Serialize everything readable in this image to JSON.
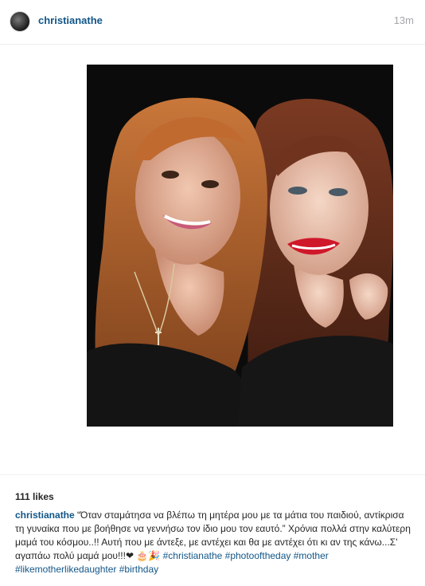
{
  "post": {
    "username": "christianathe",
    "timestamp": "13m",
    "likes": "111 likes",
    "caption_user": "christianathe",
    "caption_text": " “Όταν σταμάτησα να βλέπω τη μητέρα μου με τα μάτια του παιδιού, αντίκρισα τη γυναίκα που με βοήθησε να γεννήσω τον ίδιο μου τον εαυτό.” Χρόνια πολλά στην καλύτερη μαμά του κόσμου..!! Αυτή που με άντεξε, με αντέχει και θα με αντέχει ότι κι αν της κάνω...Σ' αγαπάω πολύ μαμά μου!!!❤ 🎂🎉 ",
    "hashtags": [
      "#christianathe",
      "#photooftheday",
      "#mother",
      "#likemotherlikedaughter",
      "#birthday"
    ]
  },
  "colors": {
    "link": "#125688",
    "text": "#262626",
    "muted": "#a5a7aa",
    "photo_background": "#0b0b0b"
  },
  "icons": {
    "avatar": "avatar-image",
    "photo": "selfie-photo-two-women"
  }
}
